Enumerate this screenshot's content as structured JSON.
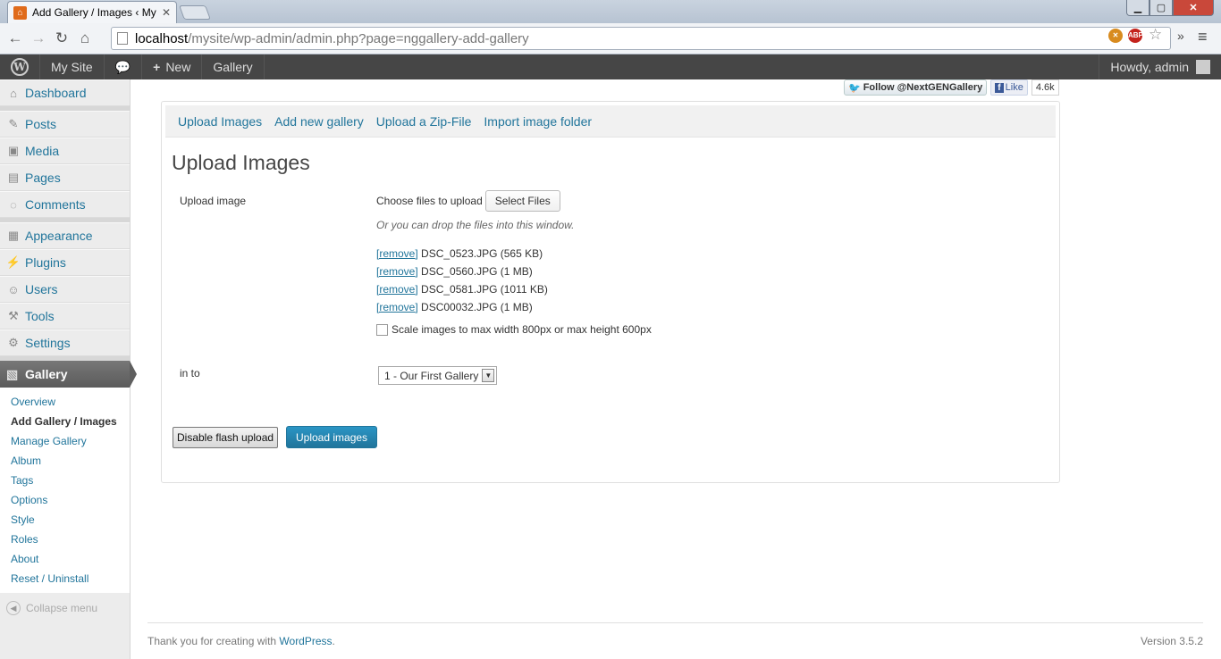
{
  "browser": {
    "tab_title": "Add Gallery / Images ‹ My",
    "tab_close": "✕",
    "url_host": "localhost",
    "url_path": "/mysite/wp-admin/admin.php?page=nggallery-add-gallery",
    "window_controls": {
      "minimize": "▁",
      "maximize": "▢",
      "close": "✕"
    },
    "icons": {
      "back": "arrow-left-icon",
      "forward": "arrow-right-icon",
      "reload": "reload-icon",
      "home": "home-icon",
      "star": "star-icon",
      "menu": "wrench-menu-icon"
    },
    "ext_badge": "ABP"
  },
  "adminbar": {
    "site": "My Site",
    "new_label": "New",
    "gallery": "Gallery",
    "howdy": "Howdy, admin"
  },
  "sidebar": {
    "items": [
      {
        "label": "Dashboard",
        "icon": "dashboard-icon"
      },
      {
        "label": "Posts",
        "icon": "pin-icon"
      },
      {
        "label": "Media",
        "icon": "media-icon"
      },
      {
        "label": "Pages",
        "icon": "pages-icon"
      },
      {
        "label": "Comments",
        "icon": "comments-icon"
      },
      {
        "label": "Appearance",
        "icon": "appearance-icon"
      },
      {
        "label": "Plugins",
        "icon": "plugins-icon"
      },
      {
        "label": "Users",
        "icon": "users-icon"
      },
      {
        "label": "Tools",
        "icon": "tools-icon"
      },
      {
        "label": "Settings",
        "icon": "settings-icon"
      }
    ],
    "gallery_label": "Gallery",
    "submenu": [
      "Overview",
      "Add Gallery / Images",
      "Manage Gallery",
      "Album",
      "Tags",
      "Options",
      "Style",
      "Roles",
      "About",
      "Reset / Uninstall"
    ],
    "collapse_label": "Collapse menu"
  },
  "social": {
    "twitter": "Follow @NextGENGallery",
    "like": "Like",
    "like_count": "4.6k"
  },
  "tabs": [
    "Upload Images",
    "Add new gallery",
    "Upload a Zip-File",
    "Import image folder"
  ],
  "page_title": "Upload Images",
  "form": {
    "upload_label": "Upload image",
    "choose_text": "Choose files to upload",
    "select_files": "Select Files",
    "drop_hint": "Or you can drop the files into this window.",
    "remove_label": "[remove]",
    "files": [
      "DSC_0523.JPG (565 KB)",
      "DSC_0560.JPG (1 MB)",
      "DSC_0581.JPG (1011 KB)",
      "DSC00032.JPG (1 MB)"
    ],
    "scale_label": "Scale images to max width 800px or max height 600px",
    "into_label": "in to",
    "gallery_selected": "1 - Our First Gallery",
    "disable_flash": "Disable flash upload",
    "upload_button": "Upload images"
  },
  "footer": {
    "thanks": "Thank you for creating with ",
    "wordpress": "WordPress",
    "period": ".",
    "version": "Version 3.5.2"
  }
}
